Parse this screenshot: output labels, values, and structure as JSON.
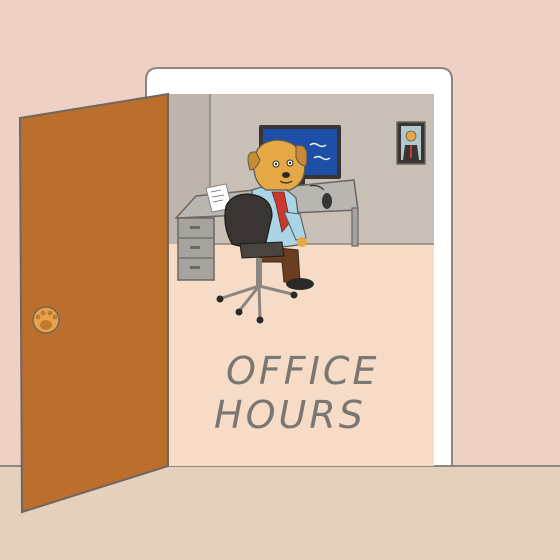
{
  "sign": {
    "line1": "OFFICE",
    "line2": "HOURS"
  },
  "colors": {
    "wall": "#EFD0C5",
    "floor": "#E5D0BC",
    "door": "#BC6E2C",
    "door_frame": "#FFFFFF",
    "office_wall": "#C8C0B7",
    "office_floor": "#F6DCC6",
    "dog_fur": "#E5A844",
    "shirt": "#A9D5E6",
    "tie": "#C83A2F",
    "monitor_screen": "#1E4FA8"
  },
  "icons": {
    "door_knob": "paw-print-icon",
    "portrait": "dog-portrait-icon"
  }
}
